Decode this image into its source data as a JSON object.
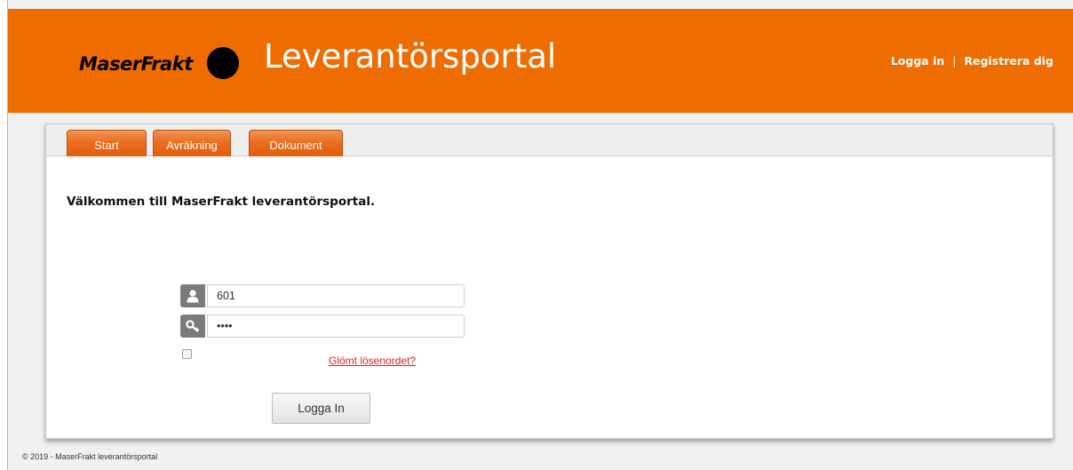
{
  "header": {
    "logo_text": "MaserFrakt",
    "logo_initial": "M",
    "title": "Leverantörsportal",
    "login_link": "Logga in",
    "separator": "|",
    "register_link": "Registrera dig",
    "brand_color": "#ee6c00"
  },
  "tabs": [
    {
      "label": "Start"
    },
    {
      "label": "Avräkning"
    },
    {
      "label": "Dokument"
    }
  ],
  "main": {
    "welcome": "Välkommen till MaserFrakt leverantörsportal.",
    "username": {
      "value": "601",
      "icon": "user-icon"
    },
    "password": {
      "value": "••••",
      "icon": "key-icon"
    },
    "remember_checked": false,
    "forgot_link": "Glömt lösenordet?",
    "login_button": "Logga In"
  },
  "footer": {
    "text": "© 2019 - MaserFrakt leverantörsportal"
  }
}
